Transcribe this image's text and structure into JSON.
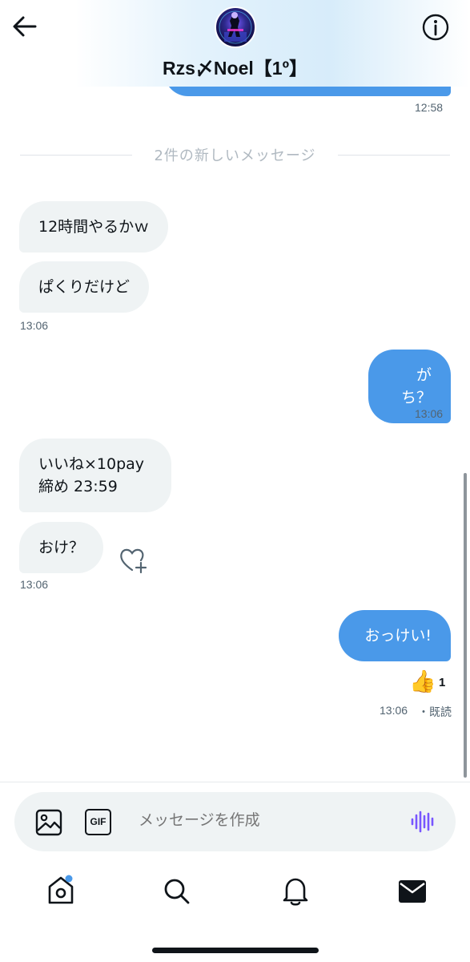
{
  "header": {
    "title": "Rzs〆Noel【1º】",
    "back_icon": "arrow-left-icon",
    "info_icon": "info-icon"
  },
  "messages": {
    "prev_time": "12:58",
    "divider": "2件の新しいメッセージ",
    "m1": "12時間やるかｗ",
    "m2": "ぱくりだけど",
    "t1": "13:06",
    "m3": "がち？",
    "t2": "13:06",
    "m4_line1": "いいね×10pay",
    "m4_line2": "締め 23:59",
    "m5": "おけ？",
    "t3": "13:06",
    "m6": "おっけい!",
    "reaction_emoji": "👍",
    "reaction_count": "1",
    "t4": "13:06",
    "read_status": "・既読"
  },
  "composer": {
    "placeholder": "メッセージを作成",
    "gif_label": "GIF"
  },
  "nav": {
    "items": [
      "home-icon",
      "search-icon",
      "bell-icon",
      "mail-icon"
    ]
  },
  "colors": {
    "accent": "#4a99e9",
    "incoming_bubble": "#eff3f4",
    "voice_icon": "#7856ff"
  }
}
